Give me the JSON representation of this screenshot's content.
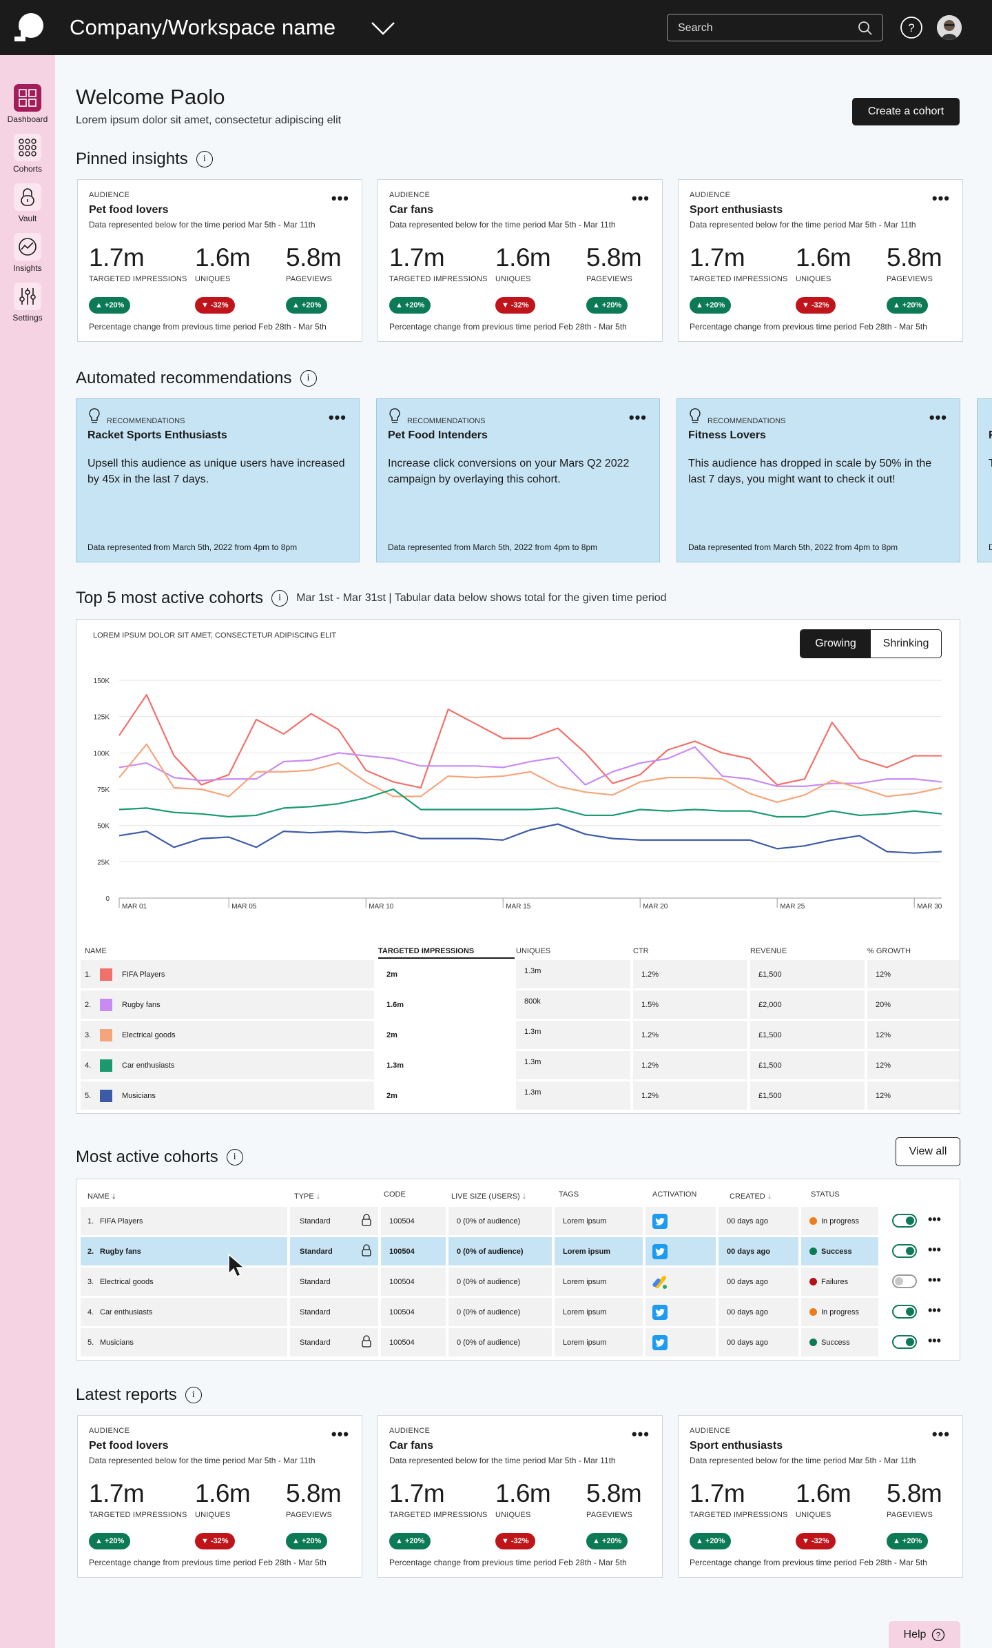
{
  "topbar": {
    "workspace_name": "Company/Workspace name",
    "search_placeholder": "Search"
  },
  "sidebar": {
    "items": [
      {
        "label": "Dashboard",
        "icon": "dashboard-icon",
        "active": true
      },
      {
        "label": "Cohorts",
        "icon": "cohorts-icon"
      },
      {
        "label": "Vault",
        "icon": "lock-icon"
      },
      {
        "label": "Insights",
        "icon": "insights-icon"
      },
      {
        "label": "Settings",
        "icon": "sliders-icon"
      }
    ]
  },
  "header": {
    "title": "Welcome Paolo",
    "subtitle": "Lorem ipsum dolor sit amet, consectetur adipiscing elit",
    "create_button": "Create a cohort"
  },
  "pinned": {
    "title": "Pinned insights",
    "cards": [
      {
        "tag": "AUDIENCE",
        "name": "Pet food lovers",
        "period": "Data represented below for the time period Mar 5th - Mar 11th",
        "m1": "1.7m",
        "l1": "TARGETED IMPRESSIONS",
        "m2": "1.6m",
        "l2": "UNIQUES",
        "m3": "5.8m",
        "l3": "PAGEVIEWS",
        "b1": "+20%",
        "b2": "-32%",
        "b3": "+20%",
        "foot": "Percentage change from previous time period Feb 28th - Mar 5th"
      },
      {
        "tag": "AUDIENCE",
        "name": "Car fans",
        "period": "Data represented below for the time period Mar 5th - Mar 11th",
        "m1": "1.7m",
        "l1": "TARGETED IMPRESSIONS",
        "m2": "1.6m",
        "l2": "UNIQUES",
        "m3": "5.8m",
        "l3": "PAGEVIEWS",
        "b1": "+20%",
        "b2": "-32%",
        "b3": "+20%",
        "foot": "Percentage change from previous time period Feb 28th - Mar 5th"
      },
      {
        "tag": "AUDIENCE",
        "name": "Sport enthusiasts",
        "period": "Data represented below for the time period Mar 5th - Mar 11th",
        "m1": "1.7m",
        "l1": "TARGETED IMPRESSIONS",
        "m2": "1.6m",
        "l2": "UNIQUES",
        "m3": "5.8m",
        "l3": "PAGEVIEWS",
        "b1": "+20%",
        "b2": "-32%",
        "b3": "+20%",
        "foot": "Percentage change from previous time period Feb 28th - Mar 5th"
      }
    ]
  },
  "recommendations": {
    "title": "Automated recommendations",
    "cards": [
      {
        "tag": "RECOMMENDATIONS",
        "name": "Racket Sports Enthusiasts",
        "desc": "Upsell this audience as unique users have increased by 45x in the last 7 days.",
        "foot": "Data represented from March 5th, 2022 from 4pm to 8pm"
      },
      {
        "tag": "RECOMMENDATIONS",
        "name": "Pet Food Intenders",
        "desc": "Increase click conversions on your Mars Q2 2022 campaign by overlaying this cohort.",
        "foot": "Data represented from March 5th, 2022 from 4pm to 8pm"
      },
      {
        "tag": "RECOMMENDATIONS",
        "name": "Fitness Lovers",
        "desc": "This audience has dropped in scale by 50% in the last 7 days, you might want to check it out!",
        "foot": "Data represented from March 5th, 2022 from 4pm to 8pm"
      }
    ],
    "partial": {
      "name": "F",
      "desc": "T",
      "foot": "D"
    }
  },
  "top5": {
    "title": "Top 5 most active cohorts",
    "note": "Mar 1st - Mar 31st | Tabular data below shows total for the given time period",
    "chart_subtitle": "LOREM IPSUM DOLOR SIT AMET, CONSECTETUR ADIPISCING ELIT",
    "toggle": [
      "Growing",
      "Shrinking"
    ],
    "columns": [
      "NAME",
      "TARGETED IMPRESSIONS",
      "UNIQUES",
      "CTR",
      "REVENUE",
      "% GROWTH"
    ],
    "rows": [
      {
        "n": "1.",
        "name": "FIFA Players",
        "color": "#f2706a",
        "imp": "2m",
        "uniq": "1.3m",
        "ctr": "1.2%",
        "rev": "£1,500",
        "growth": "12%"
      },
      {
        "n": "2.",
        "name": "Rugby fans",
        "color": "#c98af2",
        "imp": "1.6m",
        "uniq": "800k",
        "ctr": "1.5%",
        "rev": "£2,000",
        "growth": "20%"
      },
      {
        "n": "3.",
        "name": "Electrical goods",
        "color": "#f6a57a",
        "imp": "2m",
        "uniq": "1.3m",
        "ctr": "1.2%",
        "rev": "£1,500",
        "growth": "12%"
      },
      {
        "n": "4.",
        "name": "Car enthusiasts",
        "color": "#1a9a6e",
        "imp": "1.3m",
        "uniq": "1.3m",
        "ctr": "1.2%",
        "rev": "£1,500",
        "growth": "12%"
      },
      {
        "n": "5.",
        "name": "Musicians",
        "color": "#3b5aa8",
        "imp": "2m",
        "uniq": "1.3m",
        "ctr": "1.2%",
        "rev": "£1,500",
        "growth": "12%"
      }
    ]
  },
  "chart_data": {
    "type": "line",
    "x": [
      "Mar 01",
      "Mar 02",
      "Mar 03",
      "Mar 04",
      "Mar 05",
      "Mar 06",
      "Mar 07",
      "Mar 08",
      "Mar 09",
      "Mar 10",
      "Mar 11",
      "Mar 12",
      "Mar 13",
      "Mar 14",
      "Mar 15",
      "Mar 16",
      "Mar 17",
      "Mar 18",
      "Mar 19",
      "Mar 20",
      "Mar 21",
      "Mar 22",
      "Mar 23",
      "Mar 24",
      "Mar 25",
      "Mar 26",
      "Mar 27",
      "Mar 28",
      "Mar 29",
      "Mar 30",
      "Mar 31"
    ],
    "xticks": [
      "MAR 01",
      "MAR 05",
      "MAR 10",
      "MAR 15",
      "MAR 20",
      "MAR 25",
      "MAR 30"
    ],
    "yticks": [
      "0",
      "25K",
      "50K",
      "75K",
      "100K",
      "125K",
      "150K"
    ],
    "ylim": [
      0,
      150000
    ],
    "grid": true,
    "series": [
      {
        "color": "#f2706a",
        "values": [
          112000,
          140000,
          98000,
          78000,
          85000,
          123000,
          113000,
          127000,
          116000,
          88000,
          80000,
          76000,
          130000,
          120000,
          110000,
          110000,
          117000,
          100000,
          79000,
          85000,
          102000,
          108000,
          100000,
          96000,
          78000,
          82000,
          121000,
          96000,
          90000,
          98000,
          98000
        ]
      },
      {
        "color": "#c98af2",
        "values": [
          90000,
          93000,
          83000,
          81000,
          82000,
          82000,
          94000,
          95000,
          100000,
          98000,
          96000,
          91000,
          91000,
          91000,
          90000,
          94000,
          97000,
          78000,
          87000,
          93000,
          96000,
          104000,
          84000,
          82000,
          77000,
          77000,
          79000,
          79000,
          82000,
          82000,
          80000
        ]
      },
      {
        "color": "#f6a57a",
        "values": [
          83000,
          106000,
          76000,
          75000,
          70000,
          87000,
          87000,
          88000,
          93000,
          80000,
          70000,
          70000,
          84000,
          83000,
          84000,
          87000,
          77000,
          73000,
          71000,
          80000,
          83000,
          83000,
          82000,
          72000,
          66000,
          71000,
          81000,
          76000,
          70000,
          72000,
          76000
        ]
      },
      {
        "color": "#1a9a6e",
        "values": [
          61000,
          62000,
          59000,
          58000,
          56000,
          57000,
          62000,
          63000,
          65000,
          69000,
          75000,
          61000,
          61000,
          61000,
          61000,
          61000,
          62000,
          57000,
          57000,
          61000,
          60000,
          61000,
          60000,
          60000,
          56000,
          56000,
          60000,
          57000,
          58000,
          60000,
          58000
        ]
      },
      {
        "color": "#3b5aa8",
        "values": [
          43000,
          46000,
          35000,
          41000,
          42000,
          35000,
          46000,
          45000,
          46000,
          45000,
          46000,
          41000,
          41000,
          41000,
          40000,
          47000,
          51000,
          44000,
          41000,
          40000,
          40000,
          40000,
          40000,
          40000,
          34000,
          36000,
          40000,
          43000,
          32000,
          31000,
          32000
        ]
      }
    ]
  },
  "mac": {
    "title": "Most active cohorts",
    "view_all": "View all",
    "columns": [
      "NAME",
      "TYPE",
      "CODE",
      "LIVE SIZE (USERS)",
      "TAGS",
      "ACTIVATION",
      "CREATED",
      "STATUS"
    ],
    "rows": [
      {
        "n": "1.",
        "name": "FIFA Players",
        "type": "Standard",
        "lock": true,
        "code": "100504",
        "size": "0 (0% of audience)",
        "tags": "Lorem ipsum",
        "act": "twitter",
        "created": "00 days ago",
        "status": "In progress",
        "status_color": "#f07b1a",
        "on": true
      },
      {
        "n": "2.",
        "name": "Rugby fans",
        "type": "Standard",
        "lock": true,
        "code": "100504",
        "size": "0 (0% of audience)",
        "tags": "Lorem ipsum",
        "act": "twitter",
        "created": "00 days ago",
        "status": "Success",
        "status_color": "#0b7a55",
        "on": true
      },
      {
        "n": "3.",
        "name": "Electrical goods",
        "type": "Standard",
        "lock": false,
        "code": "100504",
        "size": "0 (0% of audience)",
        "tags": "Lorem ipsum",
        "act": "ads",
        "created": "00 days ago",
        "status": "Failures",
        "status_color": "#b3121a",
        "on": false
      },
      {
        "n": "4.",
        "name": "Car enthusiasts",
        "type": "Standard",
        "lock": false,
        "code": "100504",
        "size": "0 (0% of audience)",
        "tags": "Lorem ipsum",
        "act": "twitter",
        "created": "00 days ago",
        "status": "In progress",
        "status_color": "#f07b1a",
        "on": true
      },
      {
        "n": "5.",
        "name": "Musicians",
        "type": "Standard",
        "lock": true,
        "code": "100504",
        "size": "0 (0% of audience)",
        "tags": "Lorem ipsum",
        "act": "twitter",
        "created": "00 days ago",
        "status": "Success",
        "status_color": "#0b7a55",
        "on": true
      }
    ]
  },
  "reports": {
    "title": "Latest reports",
    "cards": [
      {
        "tag": "AUDIENCE",
        "name": "Pet food lovers",
        "period": "Data represented below for the time period Mar 5th - Mar 11th",
        "m1": "1.7m",
        "l1": "TARGETED IMPRESSIONS",
        "m2": "1.6m",
        "l2": "UNIQUES",
        "m3": "5.8m",
        "l3": "PAGEVIEWS",
        "b1": "+20%",
        "b2": "-32%",
        "b3": "+20%",
        "foot": "Percentage change from previous time period Feb 28th - Mar 5th"
      },
      {
        "tag": "AUDIENCE",
        "name": "Car fans",
        "period": "Data represented below for the time period Mar 5th - Mar 11th",
        "m1": "1.7m",
        "l1": "TARGETED IMPRESSIONS",
        "m2": "1.6m",
        "l2": "UNIQUES",
        "m3": "5.8m",
        "l3": "PAGEVIEWS",
        "b1": "+20%",
        "b2": "-32%",
        "b3": "+20%",
        "foot": "Percentage change from previous time period Feb 28th - Mar 5th"
      },
      {
        "tag": "AUDIENCE",
        "name": "Sport enthusiasts",
        "period": "Data represented below for the time period Mar 5th - Mar 11th",
        "m1": "1.7m",
        "l1": "TARGETED IMPRESSIONS",
        "m2": "1.6m",
        "l2": "UNIQUES",
        "m3": "5.8m",
        "l3": "PAGEVIEWS",
        "b1": "+20%",
        "b2": "-32%",
        "b3": "+20%",
        "foot": "Percentage change from previous time period Feb 28th - Mar 5th"
      }
    ]
  },
  "help_button": "Help",
  "colors": {
    "accent": "#a21d5a",
    "sidebar": "#f6d3e2",
    "rec": "#c6e4f3",
    "up": "#0b7a55",
    "down": "#c0141b"
  }
}
